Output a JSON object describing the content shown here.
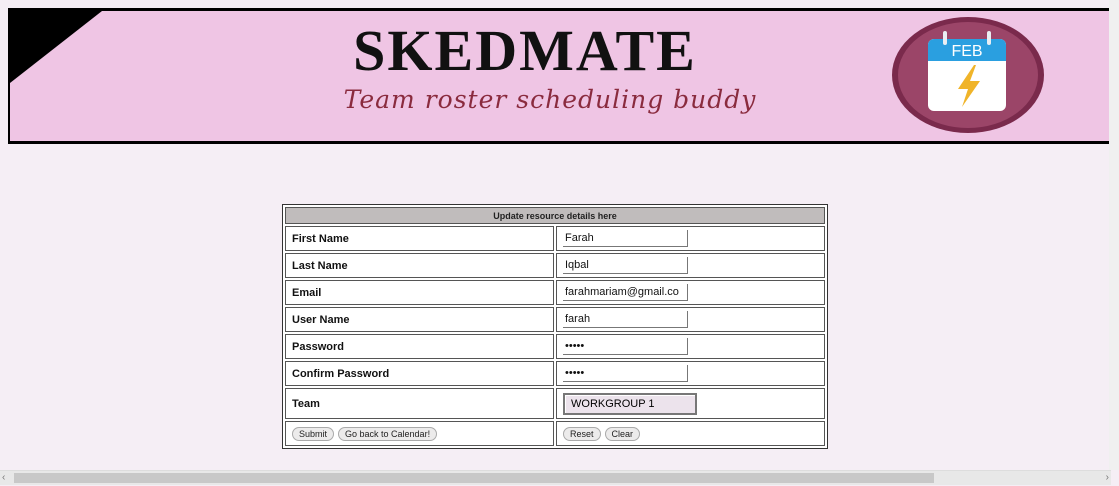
{
  "brand": {
    "title": "SKEDMATE",
    "tagline": "Team roster scheduling buddy",
    "logo_month": "FEB"
  },
  "form": {
    "heading": "Update resource details here",
    "fields": [
      {
        "label": "First Name",
        "value": "Farah"
      },
      {
        "label": "Last Name",
        "value": "Iqbal"
      },
      {
        "label": "Email",
        "value": "farahmariam@gmail.co"
      },
      {
        "label": "User Name",
        "value": "farah"
      },
      {
        "label": "Password",
        "value": "•••••"
      },
      {
        "label": "Confirm Password",
        "value": "•••••"
      }
    ],
    "team": {
      "label": "Team",
      "selected": "WORKGROUP 1"
    },
    "buttons": {
      "submit": "Submit",
      "back": "Go back to Calendar!",
      "reset": "Reset",
      "clear": "Clear"
    }
  },
  "colors": {
    "banner_bg": "#efc5e4",
    "page_bg": "#f5eef5",
    "logo_circle": "#8e3a5c",
    "calendar_header": "#2a9fe0",
    "bolt": "#f0b429"
  },
  "icons": [
    "calendar-icon",
    "lightning-bolt-icon"
  ]
}
